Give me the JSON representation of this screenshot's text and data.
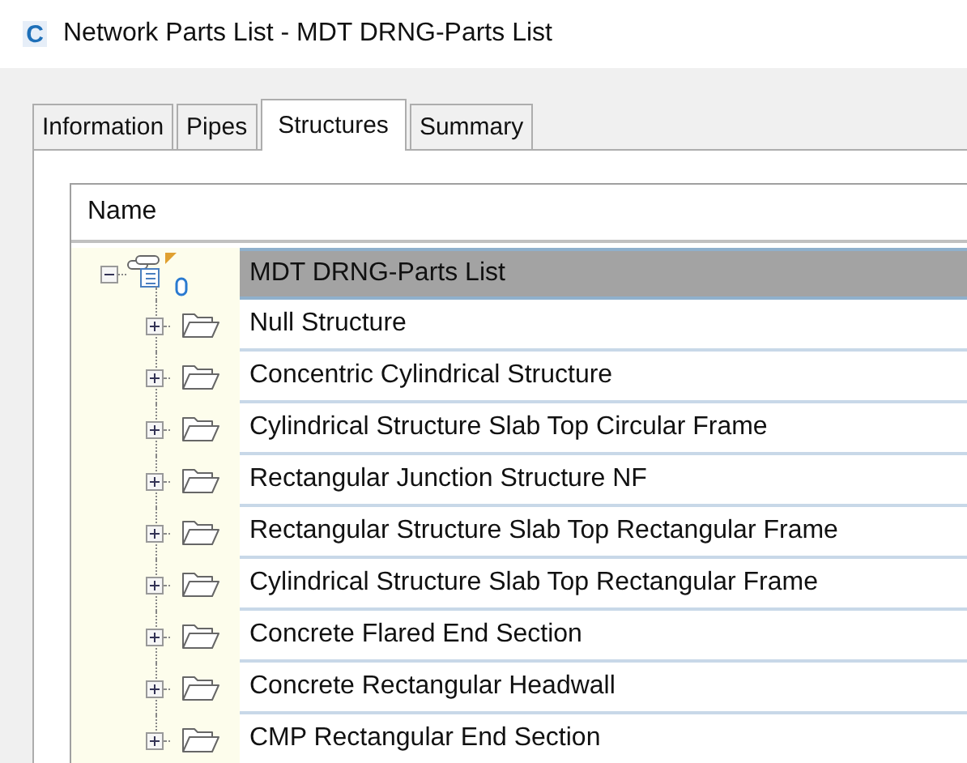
{
  "window": {
    "logo": "C",
    "title": "Network Parts List - MDT DRNG-Parts List"
  },
  "tabs": [
    {
      "label": "Information",
      "selected": false
    },
    {
      "label": "Pipes",
      "selected": false
    },
    {
      "label": "Structures",
      "selected": true
    },
    {
      "label": "Summary",
      "selected": false
    }
  ],
  "tree": {
    "columns": [
      "Name"
    ],
    "root": {
      "label": "MDT DRNG-Parts List",
      "expanded": true,
      "selected": true,
      "children": [
        {
          "label": "Null Structure",
          "expanded": false,
          "selected": false
        },
        {
          "label": "Concentric Cylindrical Structure",
          "expanded": false,
          "selected": false
        },
        {
          "label": "Cylindrical Structure Slab Top Circular Frame",
          "expanded": false,
          "selected": false
        },
        {
          "label": "Rectangular Junction Structure NF",
          "expanded": false,
          "selected": false
        },
        {
          "label": "Rectangular Structure Slab Top Rectangular Frame",
          "expanded": false,
          "selected": false
        },
        {
          "label": "Cylindrical Structure Slab Top Rectangular Frame",
          "expanded": false,
          "selected": false
        },
        {
          "label": "Concrete Flared End Section",
          "expanded": false,
          "selected": false
        },
        {
          "label": "Concrete Rectangular Headwall",
          "expanded": false,
          "selected": false
        },
        {
          "label": "CMP Rectangular End Section",
          "expanded": false,
          "selected": false
        }
      ]
    }
  }
}
